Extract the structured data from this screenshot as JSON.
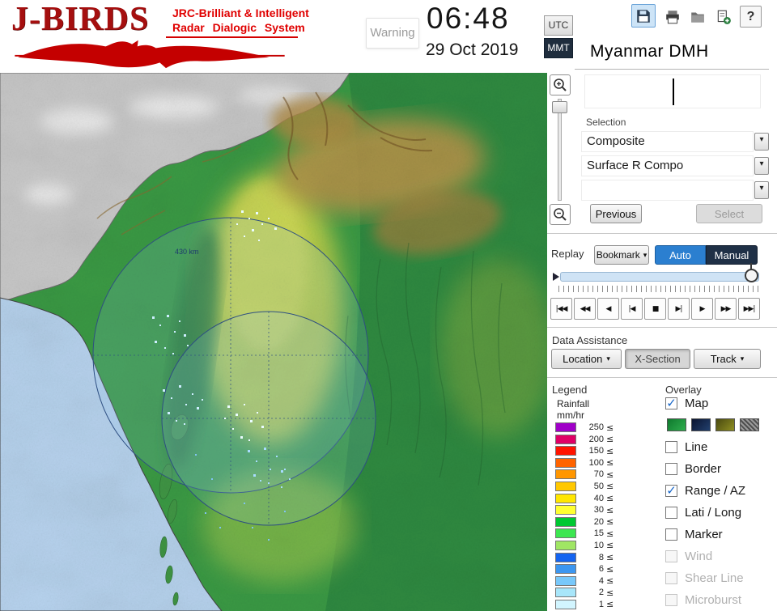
{
  "header": {
    "logo": {
      "title": "J-BIRDS",
      "tagline1": "JRC-Brilliant & Intelligent",
      "tagline2": "Radar Dialogic System"
    },
    "warning_label": "Warning",
    "clock": {
      "time": "06:48",
      "date": "29 Oct 2019"
    },
    "timezone": {
      "utc": "UTC",
      "mmt": "MMT"
    },
    "station_title": "Myanmar DMH",
    "toolbar_icons": [
      "save",
      "print",
      "folder",
      "export",
      "help"
    ],
    "help_glyph": "?"
  },
  "selection": {
    "label": "Selection",
    "dropdown1_value": "Composite",
    "dropdown2_value": "Surface R Compo",
    "previous_label": "Previous",
    "select_label": "Select"
  },
  "replay": {
    "label": "Replay",
    "bookmark_label": "Bookmark",
    "auto_label": "Auto",
    "manual_label": "Manual",
    "playback": [
      "|◀◀",
      "◀◀",
      "◀",
      "|◀",
      "■",
      "▶|",
      "▶",
      "▶▶",
      "▶▶|"
    ]
  },
  "data_assistance": {
    "label": "Data Assistance",
    "location_label": "Location",
    "xsection_label": "X-Section",
    "track_label": "Track"
  },
  "legend": {
    "label": "Legend",
    "unit_line1": "Rainfall",
    "unit_line2": "mm/hr",
    "lte": "≤",
    "entries": [
      {
        "value": "250",
        "color": "#a000c8"
      },
      {
        "value": "200",
        "color": "#e00066"
      },
      {
        "value": "150",
        "color": "#ff1400"
      },
      {
        "value": "100",
        "color": "#ff6400"
      },
      {
        "value": "70",
        "color": "#ff9600"
      },
      {
        "value": "50",
        "color": "#ffc800"
      },
      {
        "value": "40",
        "color": "#ffe600"
      },
      {
        "value": "30",
        "color": "#ffff32"
      },
      {
        "value": "20",
        "color": "#00c832"
      },
      {
        "value": "15",
        "color": "#3ce650"
      },
      {
        "value": "10",
        "color": "#a0e664"
      },
      {
        "value": "8",
        "color": "#1464f0"
      },
      {
        "value": "6",
        "color": "#3c96f0"
      },
      {
        "value": "4",
        "color": "#78c8fa"
      },
      {
        "value": "2",
        "color": "#a8e6fa"
      },
      {
        "value": "1",
        "color": "#d2f5ff"
      }
    ]
  },
  "overlay": {
    "label": "Overlay",
    "items": [
      {
        "label": "Map",
        "checked": true,
        "enabled": true
      },
      {
        "label": "Line",
        "checked": false,
        "enabled": true
      },
      {
        "label": "Border",
        "checked": false,
        "enabled": true
      },
      {
        "label": "Range / AZ",
        "checked": true,
        "enabled": true
      },
      {
        "label": "Lati / Long",
        "checked": false,
        "enabled": true
      },
      {
        "label": "Marker",
        "checked": false,
        "enabled": true
      },
      {
        "label": "Wind",
        "checked": false,
        "enabled": false
      },
      {
        "label": "Shear Line",
        "checked": false,
        "enabled": false
      },
      {
        "label": "Microburst",
        "checked": false,
        "enabled": false
      }
    ],
    "map_styles": [
      "green",
      "navy",
      "olive",
      "gray-hatch"
    ]
  },
  "map": {
    "range_label": "430 km"
  },
  "colors": {
    "brand_red": "#c00000",
    "accent_blue": "#2b7fd0",
    "mmt_dark": "#1f2d3d",
    "check_blue": "#1464c8"
  }
}
